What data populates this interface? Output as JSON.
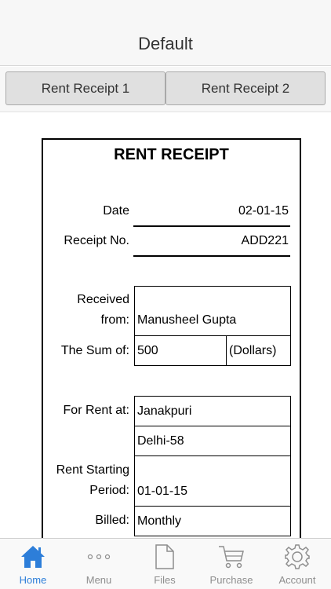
{
  "nav": {
    "title": "Default"
  },
  "segments": [
    {
      "label": "Rent Receipt 1"
    },
    {
      "label": "Rent Receipt 2"
    }
  ],
  "receipt": {
    "title": "RENT RECEIPT",
    "date_label": "Date",
    "date_value": "02-01-15",
    "receipt_no_label": "Receipt No.",
    "receipt_no_value": "ADD221",
    "received_label_1": "Received",
    "received_label_2": "from:",
    "received_value": "Manusheel Gupta",
    "sum_label": "The Sum of:",
    "sum_value": "500",
    "sum_currency": "(Dollars)",
    "rent_at_label": "For Rent at:",
    "address_line_1": "Janakpuri",
    "address_line_2": "Delhi-58",
    "period_label_1": "Rent Starting",
    "period_label_2": "Period:",
    "period_value": "01-01-15",
    "billed_label": "Billed:",
    "billed_value": "Monthly"
  },
  "tabs": [
    {
      "label": "Home",
      "icon": "home-icon",
      "active": true
    },
    {
      "label": "Menu",
      "icon": "more-icon"
    },
    {
      "label": "Files",
      "icon": "file-icon"
    },
    {
      "label": "Purchase",
      "icon": "cart-icon"
    },
    {
      "label": "Account",
      "icon": "gear-icon"
    }
  ],
  "colors": {
    "accent": "#2d7ed9",
    "inactive": "#8e8e8e"
  }
}
